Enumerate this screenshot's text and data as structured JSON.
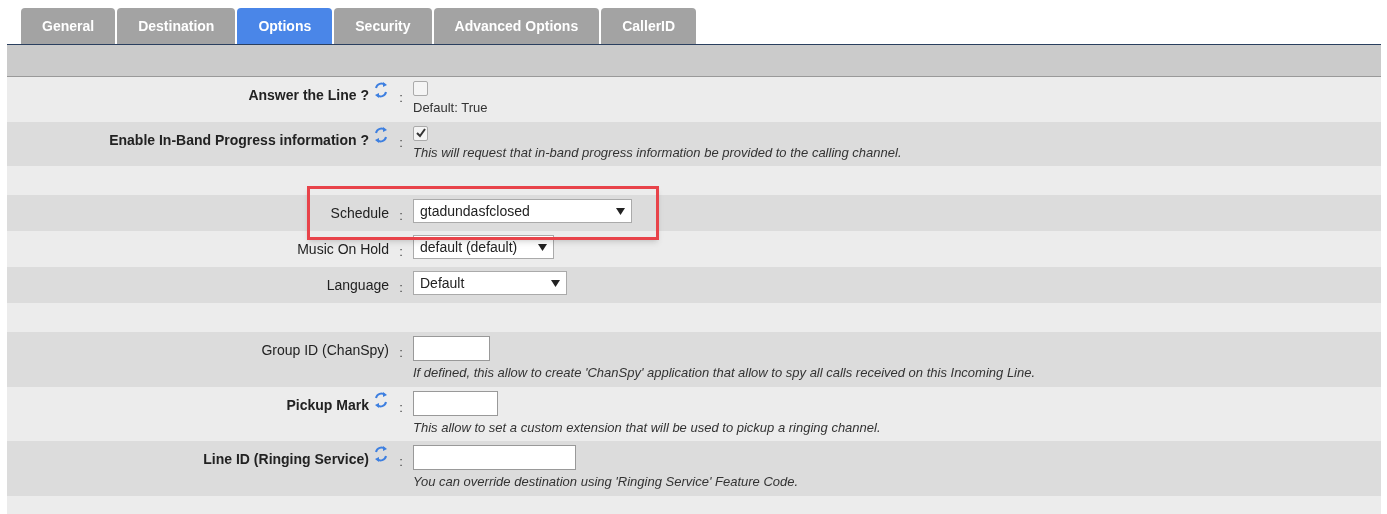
{
  "tabs": [
    {
      "label": "General",
      "selected": false
    },
    {
      "label": "Destination",
      "selected": false
    },
    {
      "label": "Options",
      "selected": true
    },
    {
      "label": "Security",
      "selected": false
    },
    {
      "label": "Advanced Options",
      "selected": false
    },
    {
      "label": "CallerID",
      "selected": false
    }
  ],
  "rows": [
    {
      "kind": "checkbox",
      "label": "Answer the Line ?",
      "sep": ":",
      "bold": true,
      "reset": true,
      "checked": false,
      "help": "Default: True",
      "help_italic": false
    },
    {
      "kind": "checkbox",
      "label": "Enable In-Band Progress information ?",
      "sep": ":",
      "bold": true,
      "reset": true,
      "checked": true,
      "help": "This will request that in-band progress information be provided to the calling channel.",
      "help_italic": true
    },
    {
      "kind": "spacer"
    },
    {
      "kind": "select",
      "label": "Schedule",
      "sep": ":",
      "bold": false,
      "reset": false,
      "value": "gtadundasfclosed",
      "highlighted": true
    },
    {
      "kind": "select",
      "label": "Music On Hold",
      "sep": ":",
      "bold": false,
      "reset": false,
      "value": "default (default)",
      "highlighted": false
    },
    {
      "kind": "select",
      "label": "Language",
      "sep": ":",
      "bold": false,
      "reset": false,
      "value": "Default",
      "highlighted": false
    },
    {
      "kind": "spacer"
    },
    {
      "kind": "text",
      "label": "Group ID (ChanSpy)",
      "sep": ":",
      "bold": false,
      "reset": false,
      "help": "If defined, this allow to create 'ChanSpy' application that allow to spy all calls received on this Incoming Line.",
      "help_italic": true
    },
    {
      "kind": "text",
      "label": "Pickup Mark",
      "sep": ":",
      "bold": true,
      "reset": true,
      "help": "This allow to set a custom extension that will be used to pickup a ringing channel.",
      "help_italic": true
    },
    {
      "kind": "text",
      "label": "Line ID (Ringing Service)",
      "sep": ":",
      "bold": true,
      "reset": true,
      "help": "You can override destination using 'Ringing Service' Feature Code.",
      "help_italic": true
    }
  ]
}
